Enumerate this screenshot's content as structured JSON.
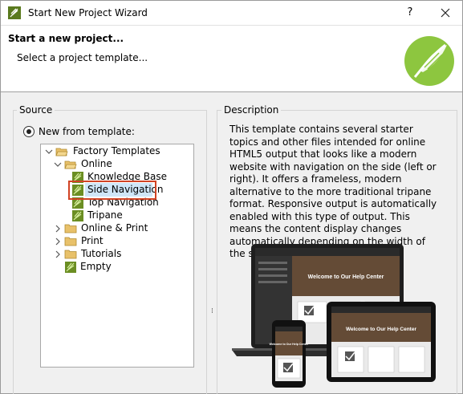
{
  "titlebar": {
    "title": "Start New Project Wizard",
    "help_label": "?",
    "app_icon": "flare-feather-icon",
    "close_icon": "close-icon"
  },
  "header": {
    "title": "Start a new project...",
    "subtitle": "Select a project template...",
    "logo_icon": "flare-feather-logo"
  },
  "source": {
    "group_label": "Source",
    "radio_label": "New from template:",
    "radio_checked": true,
    "tree": [
      {
        "label": "Factory Templates",
        "icon": "folder-open-icon",
        "expanded": true,
        "level": 0
      },
      {
        "label": "Online",
        "icon": "folder-open-icon",
        "expanded": true,
        "level": 1
      },
      {
        "label": "Knowledge Base",
        "icon": "template-icon",
        "level": 2
      },
      {
        "label": "Side Navigation",
        "icon": "template-icon",
        "level": 2,
        "selected": true
      },
      {
        "label": "Top Navigation",
        "icon": "template-icon",
        "level": 2
      },
      {
        "label": "Tripane",
        "icon": "template-icon",
        "level": 2
      },
      {
        "label": "Online & Print",
        "icon": "folder-icon",
        "expanded": false,
        "level": 1
      },
      {
        "label": "Print",
        "icon": "folder-icon",
        "expanded": false,
        "level": 1
      },
      {
        "label": "Tutorials",
        "icon": "folder-icon",
        "expanded": false,
        "level": 1
      },
      {
        "label": "Empty",
        "icon": "template-icon",
        "level": 1
      }
    ]
  },
  "description": {
    "group_label": "Description",
    "text": "This template contains several starter topics and other files intended for online HTML5 output that looks like a modern website with navigation on the side (left or right). It offers a frameless, modern alternative to the more traditional tripane format. Responsive output is automatically enabled with this type of output. This means the content display changes automatically depending on the width of the screen.",
    "preview": {
      "desktop_heading": "Welcome to Our Help Center",
      "tablet_heading": "Welcome to Our Help Center",
      "phone_heading": "Welcome to Our Help Center"
    }
  },
  "colors": {
    "accent_green": "#8dc63f",
    "selection_bg": "#cfe6f8",
    "highlight_outline": "#d14324",
    "folder": "#e8c16a"
  }
}
